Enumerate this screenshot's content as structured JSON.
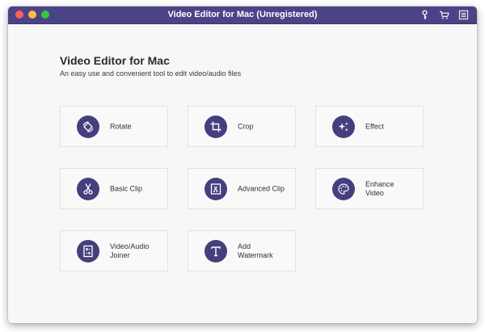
{
  "window": {
    "title": "Video Editor for Mac (Unregistered)",
    "titlebar_color": "#4a4385",
    "toolbar_icons": [
      "key-icon",
      "cart-icon",
      "menu-list-icon"
    ]
  },
  "main": {
    "heading": "Video Editor for Mac",
    "subheading": "An easy use and convenient tool to edit video/audio files"
  },
  "tools": [
    {
      "label": "Rotate",
      "icon": "rotate-icon"
    },
    {
      "label": "Crop",
      "icon": "crop-icon"
    },
    {
      "label": "Effect",
      "icon": "effect-icon"
    },
    {
      "label": "Basic Clip",
      "icon": "scissors-icon"
    },
    {
      "label": "Advanced Clip",
      "icon": "advanced-clip-icon"
    },
    {
      "label": "Enhance\nVideo",
      "icon": "enhance-palette-icon"
    },
    {
      "label": "Video/Audio\nJoiner",
      "icon": "joiner-icon"
    },
    {
      "label": "Add\nWatermark",
      "icon": "watermark-text-icon"
    }
  ],
  "colors": {
    "accent": "#453f7e",
    "close": "#fc605c",
    "minimize": "#fdbc40",
    "maximize": "#34c84a"
  }
}
